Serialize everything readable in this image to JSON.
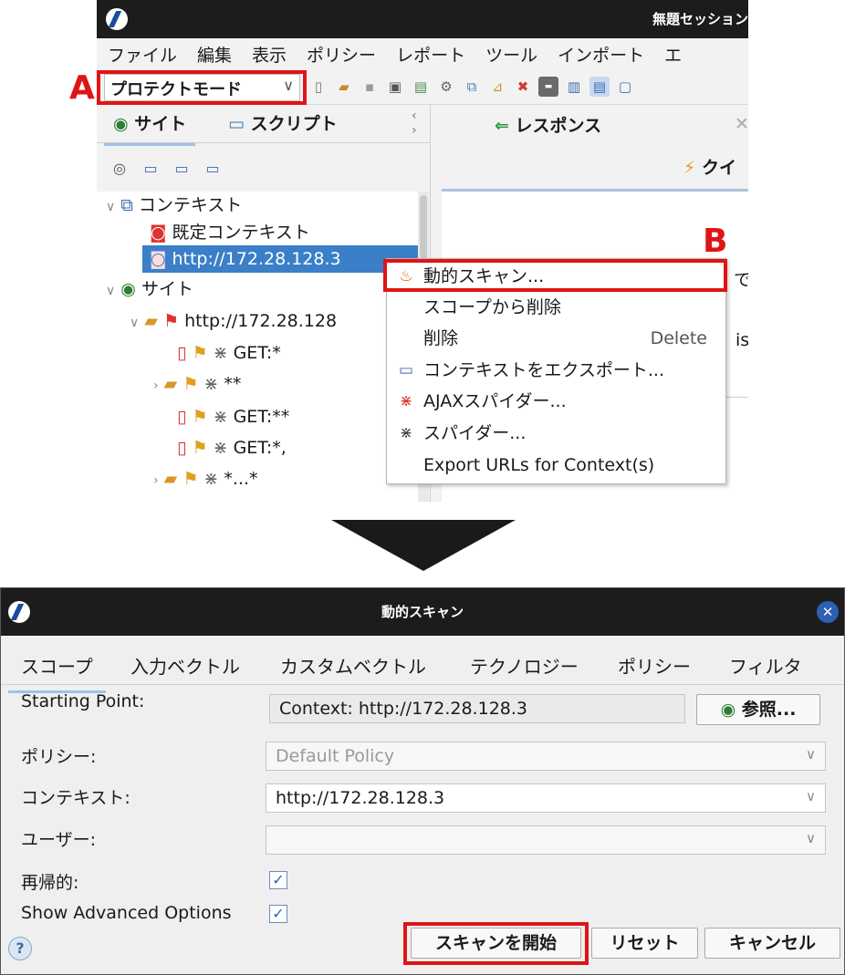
{
  "top_window": {
    "title": "無題セッション",
    "menu": [
      "ファイル",
      "編集",
      "表示",
      "ポリシー",
      "レポート",
      "ツール",
      "インポート",
      "エ"
    ],
    "mode_select": "プロテクトモード",
    "left_tabs": {
      "sites": "サイト",
      "scripts": "スクリプト"
    },
    "tree": {
      "contexts_label": "コンテキスト",
      "default_context": "既定コンテキスト",
      "selected_context": "http://172.28.128.3",
      "sites_label": "サイト",
      "site_node": "http://172.28.128",
      "children": [
        "GET:*",
        "**",
        "GET:**",
        "GET:*,",
        "*...*"
      ]
    },
    "right_tabs": {
      "response": "レスポンス",
      "quick": "クイ"
    },
    "right_fragments": [
      "で",
      "is"
    ],
    "context_menu": {
      "active_scan": "動的スキャン...",
      "remove_scope": "スコープから削除",
      "delete": "削除",
      "delete_shortcut": "Delete",
      "export_context": "コンテキストをエクスポート...",
      "ajax_spider": "AJAXスパイダー...",
      "spider": "スパイダー...",
      "export_urls": "Export URLs for Context(s)"
    }
  },
  "annotations": {
    "a": "A",
    "b": "B"
  },
  "dialog": {
    "title": "動的スキャン",
    "tabs": [
      "スコープ",
      "入力ベクトル",
      "カスタムベクトル",
      "テクノロジー",
      "ポリシー",
      "フィルタ"
    ],
    "starting_point_label": "Starting Point:",
    "starting_point_value": "Context: http://172.28.128.3",
    "browse_button": "参照...",
    "policy_label": "ポリシー:",
    "policy_value": "Default Policy",
    "context_label": "コンテキスト:",
    "context_value": "http://172.28.128.3",
    "user_label": "ユーザー:",
    "user_value": "",
    "recursive_label": "再帰的:",
    "advanced_label": "Show Advanced Options",
    "start_button": "スキャンを開始",
    "reset_button": "リセット",
    "cancel_button": "キャンセル"
  },
  "colors": {
    "highlight_red": "#e01414",
    "selection_blue": "#3a7fc8",
    "titlebar": "#1c1c1c"
  }
}
